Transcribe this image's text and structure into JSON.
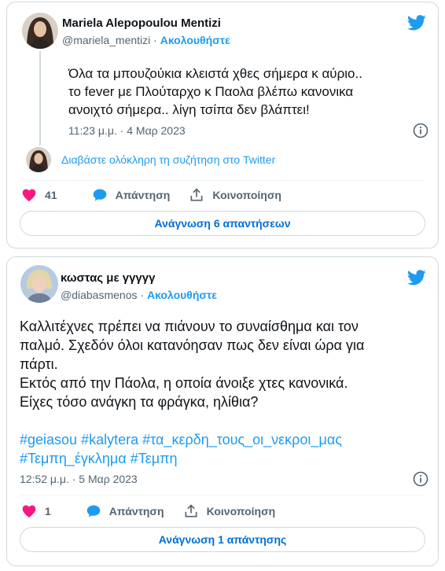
{
  "brand_color": "#1d9bf0",
  "like_color": "#f91880",
  "tweets": [
    {
      "author_name": "Mariela Alepopoulou Mentizi",
      "handle": "@mariela_mentizi",
      "separator": "·",
      "follow_label": "Ακολουθήστε",
      "text_lines": [
        "Όλα τα μπουζούκια κλειστά χθες σήμερα κ αύριο..",
        "το fever με Πλούταρχο κ Παολα βλέπω κανονικα",
        "ανοιχτό σήμερα..  λίγη τσίπα δεν βλάπτει!"
      ],
      "timestamp": "11:23 μ.μ. · 4 Μαρ 2023",
      "read_conversation": "Διαβάστε ολόκληρη τη συζήτηση στο Twitter",
      "like_count": "41",
      "reply_label": "Απάντηση",
      "share_label": "Κοινοποίηση",
      "read_replies_label": "Ανάγνωση 6 απαντήσεων",
      "icons": [
        "avatar-photo",
        "twitter-bird-icon",
        "info-icon",
        "heart-icon",
        "reply-bubble-icon",
        "share-icon"
      ]
    },
    {
      "author_name": "κωστας με γγγγγ",
      "handle": "@diabasmenos",
      "separator": "·",
      "follow_label": "Ακολουθήστε",
      "text_lines": [
        "Καλλιτέχνες πρέπει να πιάνουν το συναίσθημα και τον",
        "παλμό. Σχεδόν όλοι κατανόησαν πως δεν είναι ώρα για",
        "πάρτι.",
        "Εκτός από την Πάολα, η οποία άνοιξε χτες κανονικά.",
        "Είχες τόσο ανάγκη τα φράγκα, ηλίθια?"
      ],
      "hashtags_line1": [
        "#geiasou",
        "#kalytera",
        "#τα_κερδη_τους_οι_νεκροι_μας"
      ],
      "hashtags_line2": [
        "#Τεμπη_έγκλημα",
        "#Τεμπη"
      ],
      "timestamp": "12:52 μ.μ. · 5 Μαρ 2023",
      "like_count": "1",
      "reply_label": "Απάντηση",
      "share_label": "Κοινοποίηση",
      "read_replies_label": "Ανάγνωση 1 απάντησης",
      "icons": [
        "avatar-photo",
        "twitter-bird-icon",
        "info-icon",
        "heart-icon",
        "reply-bubble-icon",
        "share-icon"
      ]
    }
  ]
}
